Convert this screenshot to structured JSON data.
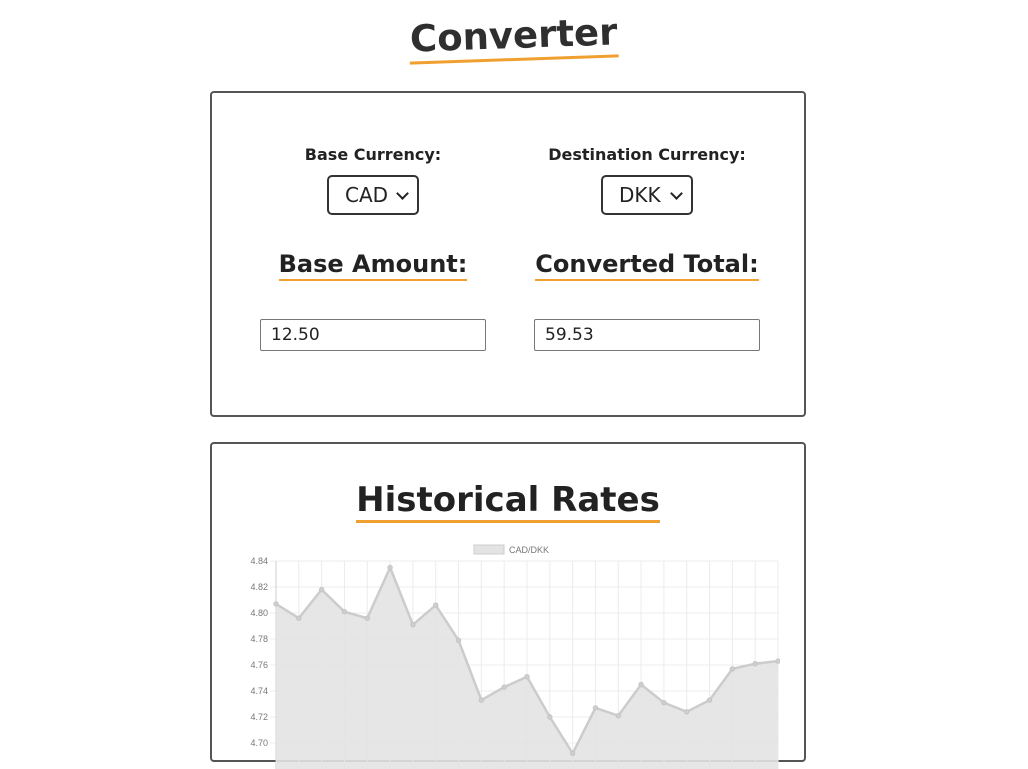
{
  "page": {
    "title": "Converter"
  },
  "converter": {
    "base_label": "Base Currency:",
    "base_value": "CAD",
    "dest_label": "Destination Currency:",
    "dest_value": "DKK",
    "base_amount_heading": "Base Amount:",
    "converted_total_heading": "Converted Total:",
    "base_amount_value": "12.50",
    "converted_total_value": "59.53"
  },
  "history": {
    "title": "Historical Rates"
  },
  "colors": {
    "accent": "#f0a030",
    "border": "#555555",
    "series_fill": "#e3e3e3",
    "series_line": "#cccccc"
  },
  "chart_data": {
    "type": "area",
    "legend": "CAD/DKK",
    "legend_position": "top",
    "grid": true,
    "ylim": [
      4.7,
      4.84
    ],
    "yticks": [
      "4.84",
      "4.82",
      "4.80",
      "4.78",
      "4.76",
      "4.74",
      "4.72",
      "4.70"
    ],
    "series": [
      {
        "name": "CAD/DKK",
        "values": [
          4.807,
          4.796,
          4.818,
          4.801,
          4.796,
          4.835,
          4.791,
          4.806,
          4.779,
          4.733,
          4.743,
          4.751,
          4.72,
          4.692,
          4.727,
          4.721,
          4.745,
          4.731,
          4.724,
          4.733,
          4.757,
          4.761,
          4.763
        ]
      }
    ]
  }
}
